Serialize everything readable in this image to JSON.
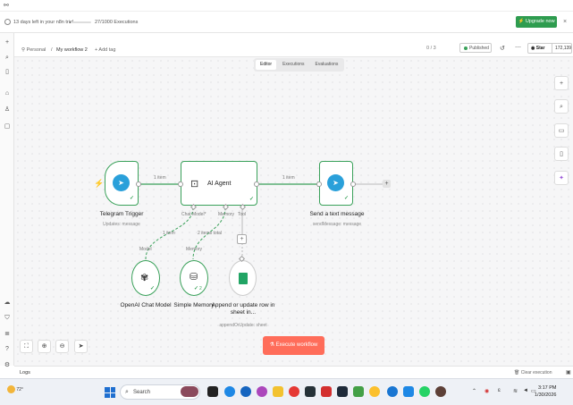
{
  "trial": {
    "text": "13 days left in your n8n trial",
    "executions": "27/1000 Executions",
    "progress": 0.027,
    "upgrade_label": "Upgrade now",
    "upgrade_color": "#2e9c4f"
  },
  "header": {
    "project": "Personal",
    "separator": "/",
    "workflow_name": "My workflow 2",
    "add_tag": "+ Add tag",
    "counter": "0 / 3",
    "status": "Published",
    "star_label": "Star",
    "star_count": "172,139"
  },
  "tabs": [
    {
      "label": "Editor",
      "active": true
    },
    {
      "label": "Executions",
      "active": false
    },
    {
      "label": "Evaluations",
      "active": false
    }
  ],
  "nodes": {
    "trigger": {
      "label": "Telegram Trigger",
      "sub": "Updates: message",
      "icon": "telegram-icon"
    },
    "agent": {
      "label": "AI Agent",
      "icon": "robot-icon",
      "ports": [
        "Chat Model*",
        "Memory",
        "Tool"
      ]
    },
    "send": {
      "label": "Send a text message",
      "sub": "sendMessage: message",
      "icon": "telegram-icon"
    },
    "openai": {
      "label": "OpenAI Chat Model",
      "icon": "openai-icon"
    },
    "memory": {
      "label": "Simple Memory",
      "icon": "database-icon",
      "badge": "2"
    },
    "sheets": {
      "label": "Append or update row in sheet in...",
      "sub": "appendOrUpdate: sheet",
      "icon": "google-sheets-icon"
    }
  },
  "edges": {
    "trigger_agent": "1 item",
    "agent_send": "1 item",
    "model": "1 item",
    "memory": "2 items total",
    "model_port": "Model",
    "memory_port": "Memory"
  },
  "execute_label": "Execute workflow",
  "execute_color": "#ff6d5a",
  "logs": {
    "label": "Logs",
    "clear": "Clear execution"
  },
  "taskbar": {
    "temp": "72°",
    "search": "Search",
    "time": "3:17 PM",
    "date": "1/30/2026"
  },
  "colors": {
    "success": "#3aa15a",
    "telegram": "#2aa0da",
    "sheets": "#21a464"
  }
}
